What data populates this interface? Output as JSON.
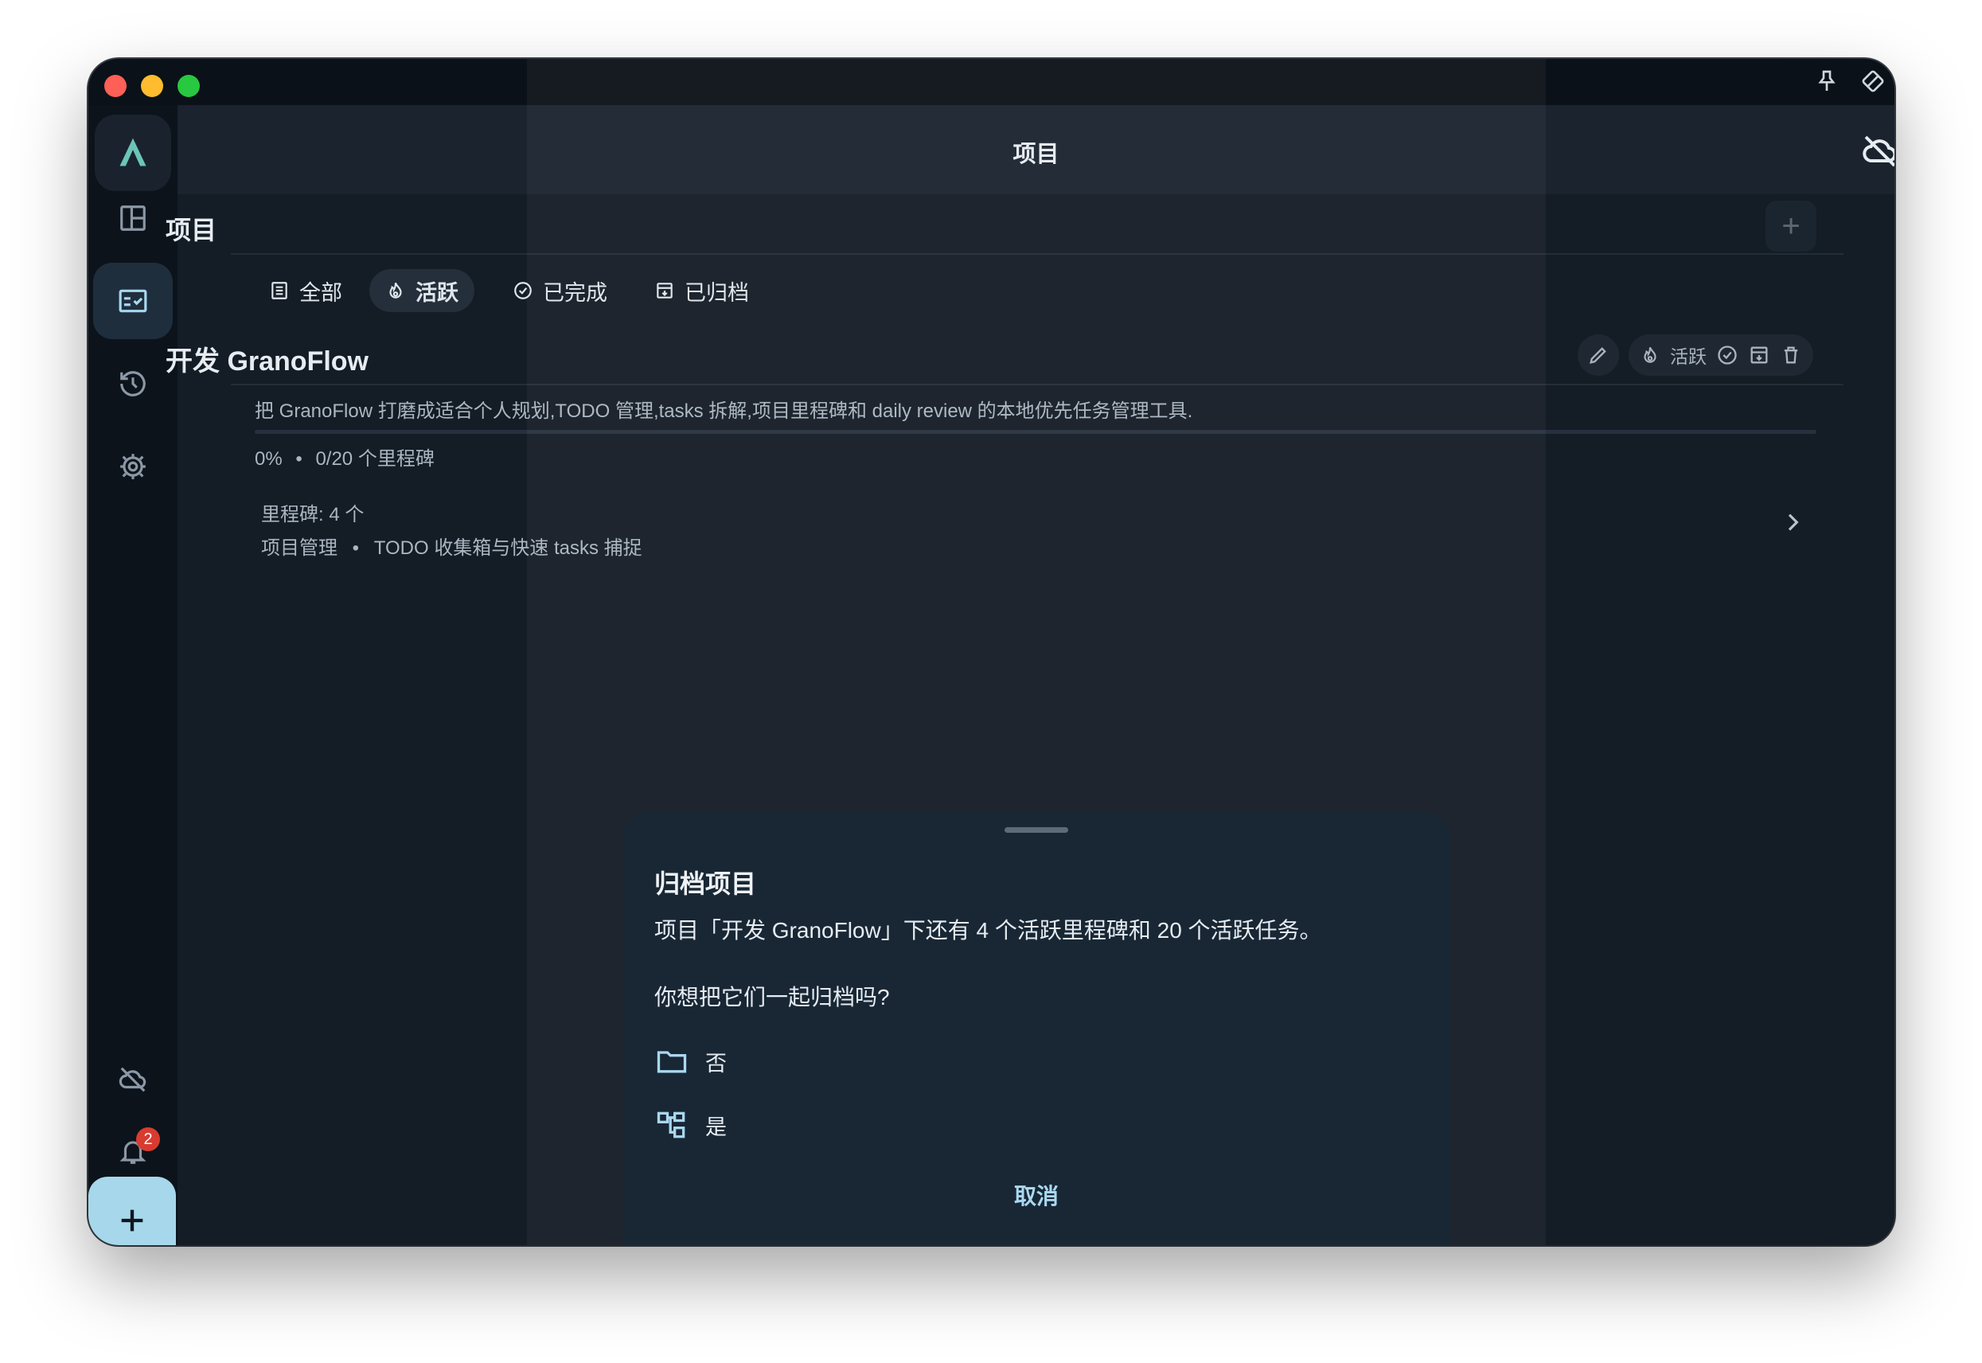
{
  "header": {
    "title": "项目"
  },
  "page": {
    "section_title": "项目"
  },
  "tabs": [
    {
      "label": "全部",
      "icon": "list-icon"
    },
    {
      "label": "活跃",
      "icon": "fire-icon"
    },
    {
      "label": "已完成",
      "icon": "check-circle-icon"
    },
    {
      "label": "已归档",
      "icon": "archive-icon"
    }
  ],
  "project": {
    "title": "开发 GranoFlow",
    "description": "把 GranoFlow 打磨成适合个人规划,TODO 管理,tasks 拆解,项目里程碑和 daily review 的本地优先任务管理工具.",
    "progress_percent": "0%",
    "progress_value": 0,
    "separator": "•",
    "milestone_progress": "0/20 个里程碑",
    "milestones_count": "里程碑: 4 个",
    "milestone_category": "项目管理",
    "milestone_name": "TODO 收集箱与快速 tasks 捕捉",
    "status_label": "活跃"
  },
  "notifications": {
    "count": "2"
  },
  "dialog": {
    "title": "归档项目",
    "message": "项目「开发 GranoFlow」下还有 4 个活跃里程碑和 20 个活跃任务。",
    "question": "你想把它们一起归档吗?",
    "option_no": "否",
    "option_yes": "是",
    "cancel": "取消"
  },
  "colors": {
    "accent": "#a7d7ea",
    "background": "#0c131b",
    "header": "#1a232e",
    "sheet": "#192735",
    "badge": "#d93b30"
  }
}
